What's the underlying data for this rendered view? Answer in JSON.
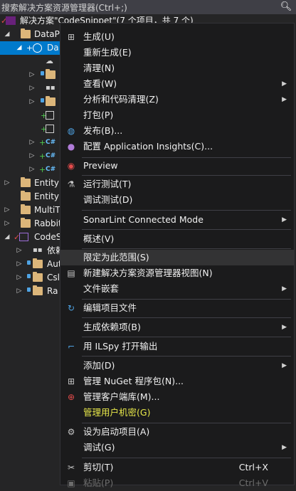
{
  "search": {
    "placeholder": "搜索解决方案资源管理器(Ctrl+;)"
  },
  "tree": {
    "solution_label": "解决方案\"CodeSnippet\"(7 个项目，共 7 个)",
    "rows": [
      {
        "label": "DataP"
      },
      {
        "label": "Da"
      },
      {
        "label": "EntityF"
      },
      {
        "label": "EntityF"
      },
      {
        "label": "MultiT"
      },
      {
        "label": "Rabbit"
      },
      {
        "label": "CodeS"
      },
      {
        "label": "依赖"
      },
      {
        "label": "Aut"
      },
      {
        "label": "Csl"
      },
      {
        "label": "Ra"
      }
    ]
  },
  "menu": {
    "items": [
      {
        "label": "生成(U)"
      },
      {
        "label": "重新生成(E)"
      },
      {
        "label": "清理(N)"
      },
      {
        "label": "查看(W)"
      },
      {
        "label": "分析和代码清理(Z)"
      },
      {
        "label": "打包(P)"
      },
      {
        "label": "发布(B)..."
      },
      {
        "label": "配置 Application Insights(C)..."
      },
      {
        "label": "Preview"
      },
      {
        "label": "运行测试(T)"
      },
      {
        "label": "调试测试(D)"
      },
      {
        "label": "SonarLint Connected Mode"
      },
      {
        "label": "概述(V)"
      },
      {
        "label": "限定为此范围(S)"
      },
      {
        "label": "新建解决方案资源管理器视图(N)"
      },
      {
        "label": "文件嵌套"
      },
      {
        "label": "编辑项目文件"
      },
      {
        "label": "生成依赖项(B)"
      },
      {
        "label": "用 ILSpy 打开输出"
      },
      {
        "label": "添加(D)"
      },
      {
        "label": "管理 NuGet 程序包(N)..."
      },
      {
        "label": "管理客户端库(M)..."
      },
      {
        "label": "管理用户机密(G)"
      },
      {
        "label": "设为启动项目(A)"
      },
      {
        "label": "调试(G)"
      },
      {
        "label": "剪切(T)",
        "shortcut": "Ctrl+X"
      },
      {
        "label": "粘贴(P)",
        "shortcut": "Ctrl+V"
      }
    ]
  },
  "colors": {
    "accent": "#007acc",
    "highlight_text": "#e8e84a"
  }
}
